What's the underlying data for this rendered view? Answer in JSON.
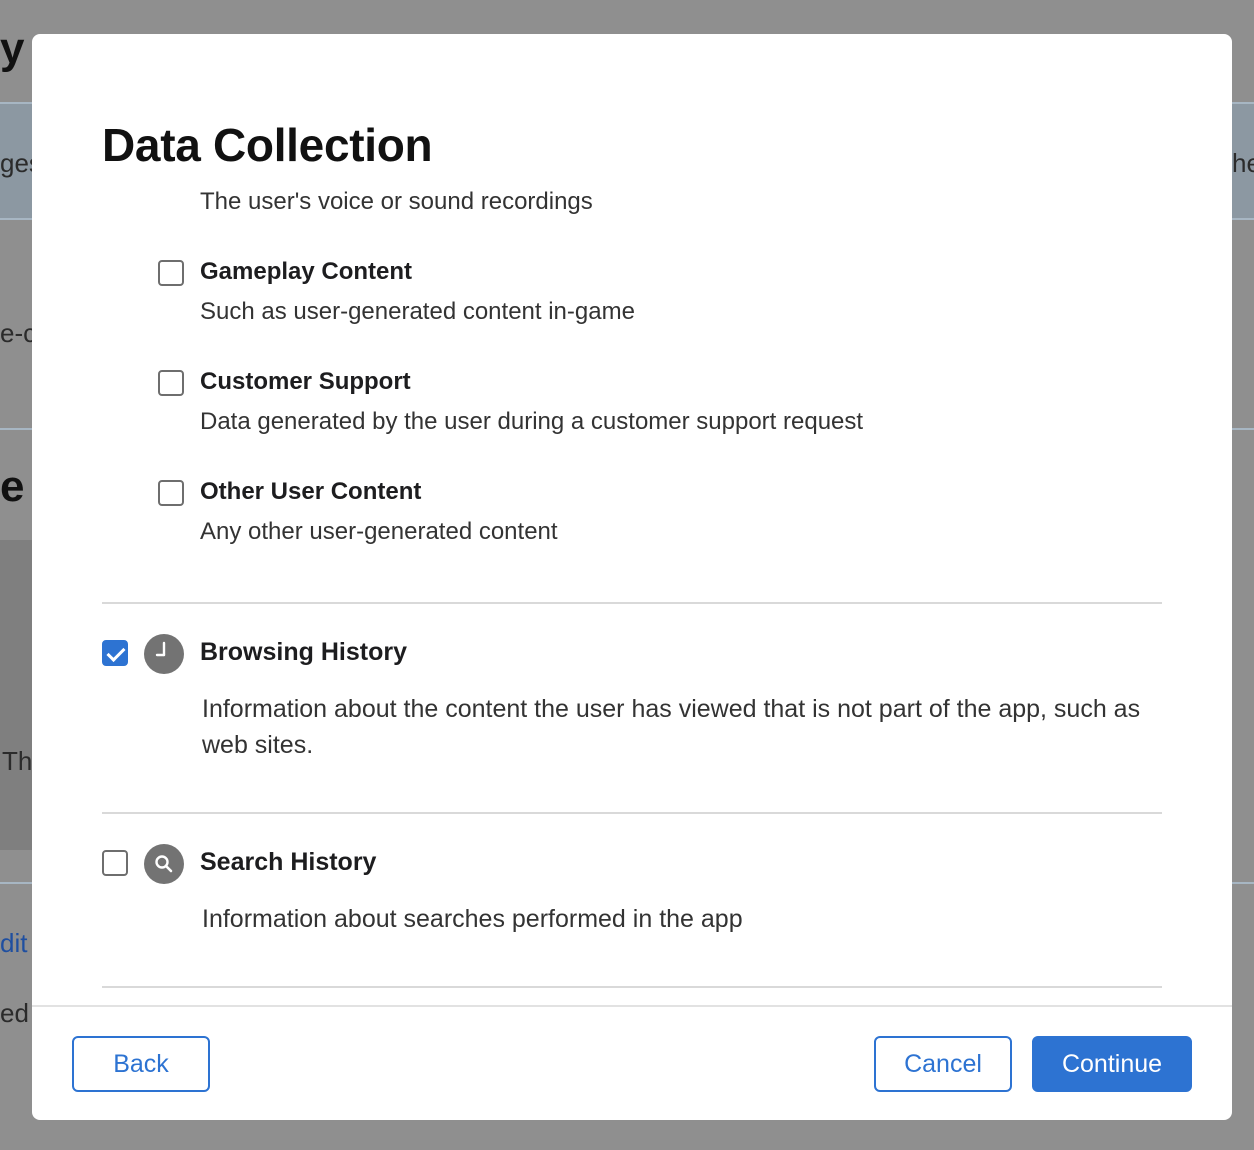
{
  "background": {
    "fragments": [
      "y",
      "ges",
      "he",
      "e-c",
      "e P",
      "Th",
      "dit",
      "ed"
    ]
  },
  "modal": {
    "title": "Data Collection",
    "partial_item_desc": "The user's voice or sound recordings",
    "sub_items": [
      {
        "label": "Gameplay Content",
        "description": "Such as user-generated content in-game",
        "checked": false
      },
      {
        "label": "Customer Support",
        "description": "Data generated by the user during a customer support request",
        "checked": false
      },
      {
        "label": "Other User Content",
        "description": "Any other user-generated content",
        "checked": false
      }
    ],
    "categories": [
      {
        "label": "Browsing History",
        "icon": "clock-icon",
        "description": "Information about the content the user has viewed that is not part of the app, such as web sites.",
        "checked": true
      },
      {
        "label": "Search History",
        "icon": "magnifier-icon",
        "description": "Information about searches performed in the app",
        "checked": false
      }
    ],
    "buttons": {
      "back": "Back",
      "cancel": "Cancel",
      "continue": "Continue"
    }
  },
  "colors": {
    "accent": "#2d73d2",
    "overlay": "#8f8f8f",
    "icon_gray": "#737373"
  }
}
